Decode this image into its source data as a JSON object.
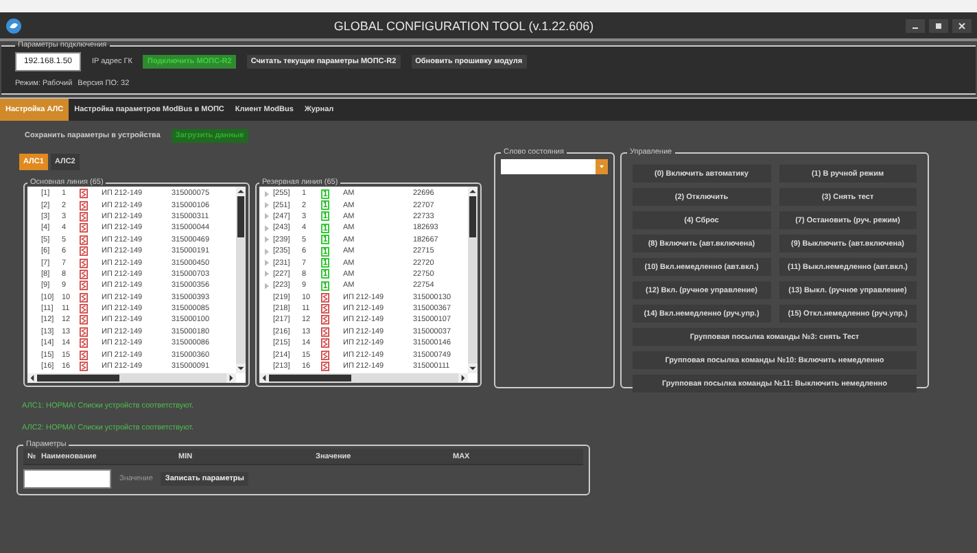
{
  "window": {
    "title": "GLOBAL CONFIGURATION TOOL (v.1.22.606)"
  },
  "connection": {
    "legend": "Параметры подключения",
    "ip": "192.168.1.50",
    "ip_label": "IP адрес ГК",
    "buttons": [
      {
        "label": "Подключить МОПС-R2",
        "kind": "green"
      },
      {
        "label": "Считать текущие параметры МОПС-R2",
        "kind": "plain"
      },
      {
        "label": "Обновить прошивку модуля",
        "kind": "plain"
      }
    ],
    "mode": "Режим: Рабочий",
    "version": "Версия ПО: 32"
  },
  "tabs": [
    {
      "label": "Настройка АЛС",
      "selected": true
    },
    {
      "label": "Настройка параметров ModBus в МОПС",
      "selected": false
    },
    {
      "label": "Клиент ModBus",
      "selected": false
    },
    {
      "label": "Журнал",
      "selected": false
    }
  ],
  "save": {
    "label": "Сохранить параметры в устройства",
    "button": "Загрузить данные"
  },
  "als_tabs": [
    {
      "label": "АЛС1",
      "selected": true
    },
    {
      "label": "АЛС2",
      "selected": false
    }
  ],
  "lists": [
    {
      "title": "Основная линия (65)",
      "rows": [
        {
          "expandable": false,
          "index": "[1]",
          "num": "1",
          "kind": "ip",
          "type": "ИП 212-149",
          "serial": "315000075"
        },
        {
          "expandable": false,
          "index": "[2]",
          "num": "2",
          "kind": "ip",
          "type": "ИП 212-149",
          "serial": "315000106"
        },
        {
          "expandable": false,
          "index": "[3]",
          "num": "3",
          "kind": "ip",
          "type": "ИП 212-149",
          "serial": "315000311"
        },
        {
          "expandable": false,
          "index": "[4]",
          "num": "4",
          "kind": "ip",
          "type": "ИП 212-149",
          "serial": "315000044"
        },
        {
          "expandable": false,
          "index": "[5]",
          "num": "5",
          "kind": "ip",
          "type": "ИП 212-149",
          "serial": "315000469"
        },
        {
          "expandable": false,
          "index": "[6]",
          "num": "6",
          "kind": "ip",
          "type": "ИП 212-149",
          "serial": "315000191"
        },
        {
          "expandable": false,
          "index": "[7]",
          "num": "7",
          "kind": "ip",
          "type": "ИП 212-149",
          "serial": "315000450"
        },
        {
          "expandable": false,
          "index": "[8]",
          "num": "8",
          "kind": "ip",
          "type": "ИП 212-149",
          "serial": "315000703"
        },
        {
          "expandable": false,
          "index": "[9]",
          "num": "9",
          "kind": "ip",
          "type": "ИП 212-149",
          "serial": "315000356"
        },
        {
          "expandable": false,
          "index": "[10]",
          "num": "10",
          "kind": "ip",
          "type": "ИП 212-149",
          "serial": "315000393"
        },
        {
          "expandable": false,
          "index": "[11]",
          "num": "11",
          "kind": "ip",
          "type": "ИП 212-149",
          "serial": "315000085"
        },
        {
          "expandable": false,
          "index": "[12]",
          "num": "12",
          "kind": "ip",
          "type": "ИП 212-149",
          "serial": "315000100"
        },
        {
          "expandable": false,
          "index": "[13]",
          "num": "13",
          "kind": "ip",
          "type": "ИП 212-149",
          "serial": "315000180"
        },
        {
          "expandable": false,
          "index": "[14]",
          "num": "14",
          "kind": "ip",
          "type": "ИП 212-149",
          "serial": "315000086"
        },
        {
          "expandable": false,
          "index": "[15]",
          "num": "15",
          "kind": "ip",
          "type": "ИП 212-149",
          "serial": "315000360"
        },
        {
          "expandable": false,
          "index": "[16]",
          "num": "16",
          "kind": "ip",
          "type": "ИП 212-149",
          "serial": "315000091"
        }
      ]
    },
    {
      "title": "Резервная линия (65)",
      "rows": [
        {
          "expandable": true,
          "index": "[255]",
          "num": "1",
          "kind": "am",
          "badge": "1",
          "type": "АМ",
          "serial": "22696"
        },
        {
          "expandable": true,
          "index": "[251]",
          "num": "2",
          "kind": "am",
          "badge": "1",
          "type": "АМ",
          "serial": "22707"
        },
        {
          "expandable": true,
          "index": "[247]",
          "num": "3",
          "kind": "am",
          "badge": "1",
          "type": "АМ",
          "serial": "22733"
        },
        {
          "expandable": true,
          "index": "[243]",
          "num": "4",
          "kind": "am",
          "badge": "1",
          "type": "АМ",
          "serial": "182693"
        },
        {
          "expandable": true,
          "index": "[239]",
          "num": "5",
          "kind": "am",
          "badge": "1",
          "type": "АМ",
          "serial": "182667"
        },
        {
          "expandable": true,
          "index": "[235]",
          "num": "6",
          "kind": "am",
          "badge": "1",
          "type": "АМ",
          "serial": "22715"
        },
        {
          "expandable": true,
          "index": "[231]",
          "num": "7",
          "kind": "am",
          "badge": "1",
          "type": "АМ",
          "serial": "22720"
        },
        {
          "expandable": true,
          "index": "[227]",
          "num": "8",
          "kind": "am",
          "badge": "1",
          "type": "АМ",
          "serial": "22750"
        },
        {
          "expandable": true,
          "index": "[223]",
          "num": "9",
          "kind": "am",
          "badge": "1",
          "type": "АМ",
          "serial": "22754"
        },
        {
          "expandable": false,
          "index": "[219]",
          "num": "10",
          "kind": "ip",
          "type": "ИП 212-149",
          "serial": "315000130"
        },
        {
          "expandable": false,
          "index": "[218]",
          "num": "11",
          "kind": "ip",
          "type": "ИП 212-149",
          "serial": "315000367"
        },
        {
          "expandable": false,
          "index": "[217]",
          "num": "12",
          "kind": "ip",
          "type": "ИП 212-149",
          "serial": "315000107"
        },
        {
          "expandable": false,
          "index": "[216]",
          "num": "13",
          "kind": "ip",
          "type": "ИП 212-149",
          "serial": "315000037"
        },
        {
          "expandable": false,
          "index": "[215]",
          "num": "14",
          "kind": "ip",
          "type": "ИП 212-149",
          "serial": "315000146"
        },
        {
          "expandable": false,
          "index": "[214]",
          "num": "15",
          "kind": "ip",
          "type": "ИП 212-149",
          "serial": "315000749"
        },
        {
          "expandable": false,
          "index": "[213]",
          "num": "16",
          "kind": "ip",
          "type": "ИП 212-149",
          "serial": "315000111"
        }
      ]
    }
  ],
  "status_word": {
    "legend": "Слово состояния"
  },
  "control": {
    "legend": "Управление",
    "buttons": [
      {
        "label": "(0) Включить автоматику",
        "kind": "half"
      },
      {
        "label": "(1) В ручной режим",
        "kind": "half"
      },
      {
        "label": "(2) Отключить",
        "kind": "half"
      },
      {
        "label": "(3) Снять тест",
        "kind": "half"
      },
      {
        "label": "(4) Сброс",
        "kind": "half"
      },
      {
        "label": "(7) Остановить (руч. режим)",
        "kind": "half"
      },
      {
        "label": "(8) Включить (авт.включена)",
        "kind": "half"
      },
      {
        "label": "(9) Выключить (авт.включена)",
        "kind": "half"
      },
      {
        "label": "(10) Вкл.немедленно (авт.вкл.)",
        "kind": "half"
      },
      {
        "label": "(11) Выкл.немедленно (авт.вкл.)",
        "kind": "half"
      },
      {
        "label": "(12) Вкл. (ручное управление)",
        "kind": "half"
      },
      {
        "label": "(13) Выкл. (ручное управление)",
        "kind": "half"
      },
      {
        "label": "(14) Вкл.немедленно (руч.упр.)",
        "kind": "half"
      },
      {
        "label": "(15) Откл.немедленно (руч.упр.)",
        "kind": "half"
      },
      {
        "label": "Групповая посылка команды №3: снять Тест",
        "kind": "full"
      },
      {
        "label": "Групповая посылка команды №10: Включить немедленно",
        "kind": "full"
      },
      {
        "label": "Групповая посылка команды №11: Выключить немедленно",
        "kind": "full"
      }
    ]
  },
  "messages": [
    "АЛС1: НОРМА! Списки устройств соответствуют.",
    "АЛС2: НОРМА! Списки устройств соответствуют."
  ],
  "parameters": {
    "legend": "Параметры",
    "columns": [
      "№",
      "Наименование",
      "MIN",
      "Значение",
      "MAX"
    ],
    "value_label": "Значение",
    "write_button": "Записать параметры"
  }
}
